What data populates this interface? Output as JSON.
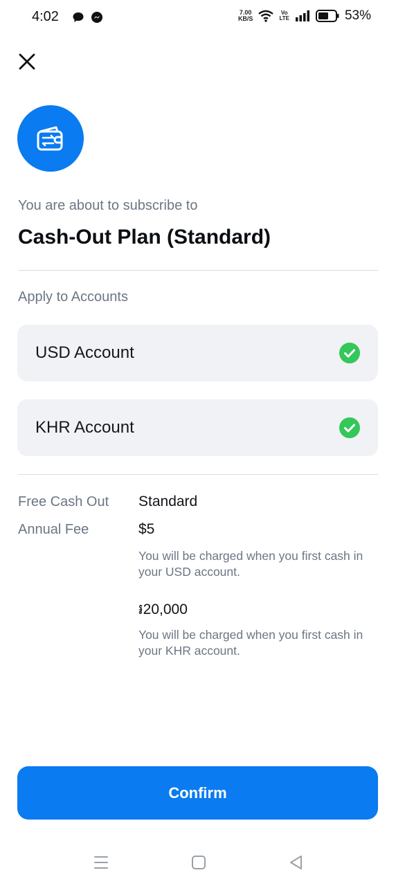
{
  "status_bar": {
    "time": "4:02",
    "net_speed_value": "7.00",
    "net_speed_unit": "KB/S",
    "volte_top": "Vo",
    "volte_bottom": "LTE",
    "battery_percent": "53%"
  },
  "icons": {
    "close": "close-icon",
    "plan": "wallet-exchange-icon",
    "check": "check-circle-icon"
  },
  "subscription": {
    "intro": "You are about to subscribe to",
    "plan_name": "Cash-Out Plan (Standard)"
  },
  "accounts_section": {
    "label": "Apply to Accounts",
    "accounts": [
      {
        "name": "USD Account",
        "selected": true
      },
      {
        "name": "KHR Account",
        "selected": true
      }
    ]
  },
  "details": {
    "free_cash_out_label": "Free Cash Out",
    "free_cash_out_value": "Standard",
    "annual_fee_label": "Annual Fee",
    "fees": [
      {
        "amount": "$5",
        "note": "You will be charged when you first cash in your USD account."
      },
      {
        "amount": "៛20,000",
        "note": "You will be charged when you first cash in your KHR account."
      }
    ]
  },
  "confirm_label": "Confirm",
  "colors": {
    "primary": "#0a7bf0",
    "check": "#34c759",
    "card_bg": "#f1f2f5",
    "muted_text": "#6b7684"
  }
}
